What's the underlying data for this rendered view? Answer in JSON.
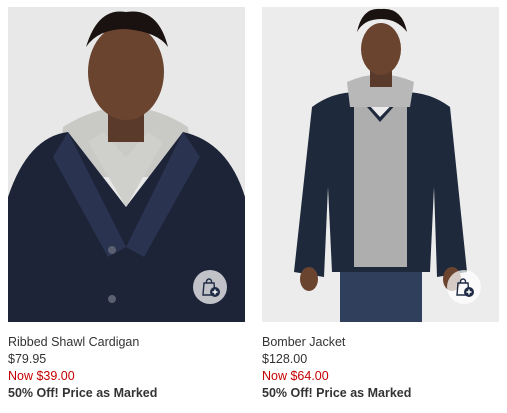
{
  "colors": {
    "sale": "#c40000",
    "text": "#333333",
    "icon": "#1f2a44"
  },
  "products": [
    {
      "name": "Ribbed Shawl Cardigan",
      "original_price": "$79.95",
      "sale_price": "Now $39.00",
      "promo": "50% Off! Price as Marked",
      "image_desc_icon": "product-photo",
      "quick_add_icon": "shopping-bag-add-icon"
    },
    {
      "name": "Bomber Jacket",
      "original_price": "$128.00",
      "sale_price": "Now $64.00",
      "promo": "50% Off! Price as Marked",
      "image_desc_icon": "product-photo",
      "quick_add_icon": "shopping-bag-add-icon"
    }
  ]
}
